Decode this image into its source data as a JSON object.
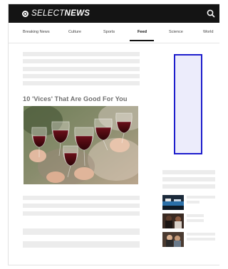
{
  "header": {
    "logo_prefix": "SELECT",
    "logo_suffix": "NEWS",
    "logo_icon": "logo-mark-icon",
    "search_icon": "search-icon"
  },
  "nav": {
    "items": [
      {
        "label": "Breaking News"
      },
      {
        "label": "Culture"
      },
      {
        "label": "Sports"
      },
      {
        "label": "Feed"
      },
      {
        "label": "Science"
      },
      {
        "label": "World"
      }
    ],
    "active": "Feed"
  },
  "article": {
    "headline": "10 'Vices' That Are Good For You",
    "image": "toast-wine-glasses-photo"
  },
  "sidebar": {
    "ad": "ad-placeholder",
    "thumbnails": [
      "video-thumbnail-1",
      "video-thumbnail-2",
      "video-thumbnail-3"
    ]
  },
  "colors": {
    "topbar": "#141414",
    "placeholder": "#ececec",
    "ad_fill": "#ececfb",
    "ad_border": "#1d1dcc",
    "headline": "#6f6f6f"
  }
}
